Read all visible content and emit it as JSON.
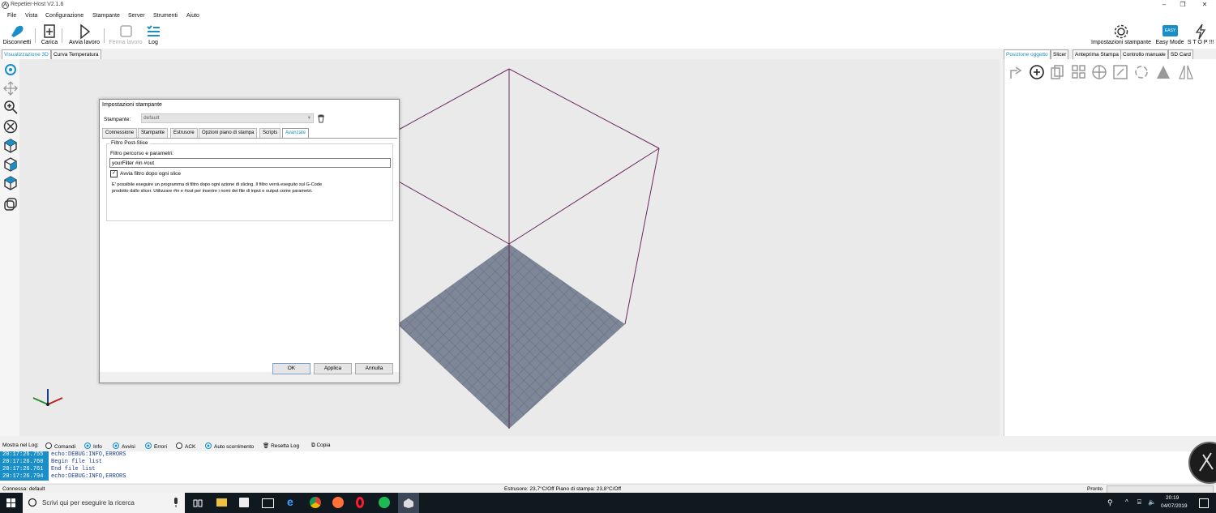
{
  "window": {
    "title": "Repetier-Host V2.1.6",
    "minimize": "‒",
    "maximize": "❐",
    "close": "✕"
  },
  "menu": [
    "File",
    "Vista",
    "Configurazione",
    "Stampante",
    "Server",
    "Strumenti",
    "Aiuto"
  ],
  "toolbar": {
    "disconnect": "Disconnetti",
    "load": "Carica",
    "start_job": "Avvia lavoro",
    "stop_job": "Ferma lavoro",
    "log": "Log",
    "printer_settings": "Impostazioni stampante",
    "easy_mode": "Easy Mode",
    "easy_badge": "EASY",
    "stop": "S T O P !!!"
  },
  "left_tabs": [
    "Visualizzazione 3D",
    "Curva Temperatura"
  ],
  "right_tabs": [
    "Posizione oggetto",
    "Slicer",
    "Anteprima Stampa",
    "Controllo manuale",
    "SD Card"
  ],
  "dialog": {
    "title": "Impostazioni stampante",
    "printer_label": "Stampante:",
    "printer_value": "default",
    "tabs": [
      "Connessione",
      "Stampante",
      "Estrusore",
      "Opzioni piano di stampa",
      "Scripts",
      "Avanzate"
    ],
    "group_title": "Filtro Post-Slice",
    "filter_label": "Filtro percorso e parametri:",
    "filter_value": "yourFilter #in #out",
    "checkbox_label": "Avvia filtro dopo ogni slice",
    "description_line1": "E' possibile eseguire un programma di filtro dopo ogni azione di slicing. Il filtro verrà eseguito sul G-Code",
    "description_line2": "prodotto dallo slicer. Utilizzare #in e #out per inserire i nomi dei file di input e output come parametri.",
    "ok": "OK",
    "apply": "Applica",
    "cancel": "Annulla"
  },
  "logbar": {
    "show_label": "Mostra nel Log:",
    "commands": "Comandi",
    "info": "Info",
    "warnings": "Avvisi",
    "errors": "Errori",
    "ack": "ACK",
    "autoscroll": "Auto scorrimento",
    "reset": "Resetta Log",
    "copy": "Copia"
  },
  "log": [
    {
      "time": "20:17:26.755",
      "msg": "echo:DEBUG:INFO,ERRORS"
    },
    {
      "time": "20:17:26.760",
      "msg": "Begin file list"
    },
    {
      "time": "20:17:26.761",
      "msg": "End file list"
    },
    {
      "time": "20:17:26.794",
      "msg": "echo:DEBUG:INFO,ERRORS"
    }
  ],
  "status": {
    "connection": "Connessa: default",
    "temps": "Estrusore: 23,7°C/Off Piano di stampa: 23,8°C/Off",
    "ready": "Pronto"
  },
  "taskbar": {
    "search_placeholder": "Scrivi qui per eseguire la ricerca",
    "time": "20:19",
    "date": "04/07/2019"
  },
  "colors": {
    "accent": "#1a8fc7",
    "bed": "#7d8797",
    "cube": "#6b2a5e"
  }
}
